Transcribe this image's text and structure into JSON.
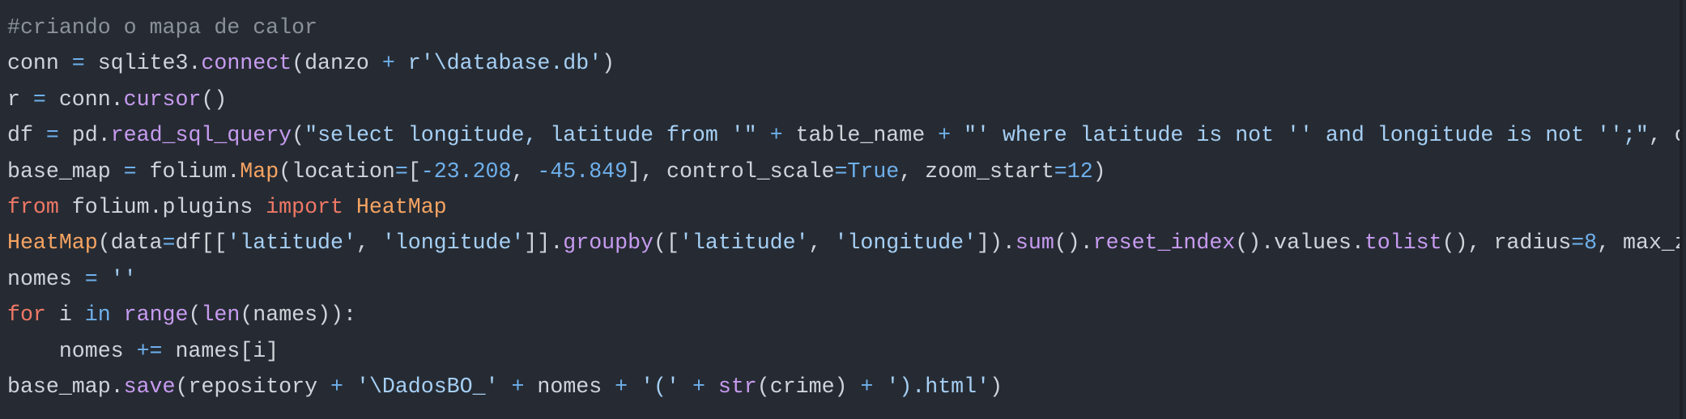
{
  "colors": {
    "background": "#262b33",
    "plain": "#d0d4da",
    "comment": "#8a919b",
    "operator": "#6fb0ec",
    "function": "#c79bf0",
    "string": "#a6cff4",
    "number": "#6fb0ec",
    "keyword": "#f07866",
    "class_name": "#f7a462"
  },
  "code": {
    "lines": [
      [
        [
          "comment",
          "#criando o mapa de calor"
        ]
      ],
      [
        [
          "plain",
          "conn "
        ],
        [
          "operator",
          "="
        ],
        [
          "plain",
          " sqlite3."
        ],
        [
          "function",
          "connect"
        ],
        [
          "plain",
          "(danzo "
        ],
        [
          "operator",
          "+"
        ],
        [
          "plain",
          " "
        ],
        [
          "string",
          "r'\\database.db'"
        ],
        [
          "plain",
          ")"
        ]
      ],
      [
        [
          "plain",
          "r "
        ],
        [
          "operator",
          "="
        ],
        [
          "plain",
          " conn."
        ],
        [
          "function",
          "cursor"
        ],
        [
          "plain",
          "()"
        ]
      ],
      [
        [
          "plain",
          "df "
        ],
        [
          "operator",
          "="
        ],
        [
          "plain",
          " pd."
        ],
        [
          "function",
          "read_sql_query"
        ],
        [
          "plain",
          "("
        ],
        [
          "string",
          "\"select longitude, latitude from '\""
        ],
        [
          "plain",
          " "
        ],
        [
          "operator",
          "+"
        ],
        [
          "plain",
          " table_name "
        ],
        [
          "operator",
          "+"
        ],
        [
          "plain",
          " "
        ],
        [
          "string",
          "\"' where latitude is not '' and longitude is not '';\""
        ],
        [
          "plain",
          ", c"
        ]
      ],
      [
        [
          "plain",
          "base_map "
        ],
        [
          "operator",
          "="
        ],
        [
          "plain",
          " folium."
        ],
        [
          "class_name",
          "Map"
        ],
        [
          "plain",
          "(location"
        ],
        [
          "operator",
          "="
        ],
        [
          "plain",
          "["
        ],
        [
          "number",
          "-23.208"
        ],
        [
          "plain",
          ", "
        ],
        [
          "number",
          "-45.849"
        ],
        [
          "plain",
          "], control_scale"
        ],
        [
          "operator",
          "="
        ],
        [
          "number",
          "True"
        ],
        [
          "plain",
          ", zoom_start"
        ],
        [
          "operator",
          "="
        ],
        [
          "number",
          "12"
        ],
        [
          "plain",
          ")"
        ]
      ],
      [
        [
          "keyword",
          "from"
        ],
        [
          "plain",
          " folium.plugins "
        ],
        [
          "keyword",
          "import"
        ],
        [
          "plain",
          " "
        ],
        [
          "class_name",
          "HeatMap"
        ]
      ],
      [
        [
          "class_name",
          "HeatMap"
        ],
        [
          "plain",
          "(data"
        ],
        [
          "operator",
          "="
        ],
        [
          "plain",
          "df[["
        ],
        [
          "string",
          "'latitude'"
        ],
        [
          "plain",
          ", "
        ],
        [
          "string",
          "'longitude'"
        ],
        [
          "plain",
          "]]."
        ],
        [
          "function",
          "groupby"
        ],
        [
          "plain",
          "(["
        ],
        [
          "string",
          "'latitude'"
        ],
        [
          "plain",
          ", "
        ],
        [
          "string",
          "'longitude'"
        ],
        [
          "plain",
          "])."
        ],
        [
          "function",
          "sum"
        ],
        [
          "plain",
          "()."
        ],
        [
          "function",
          "reset_index"
        ],
        [
          "plain",
          "().values."
        ],
        [
          "function",
          "tolist"
        ],
        [
          "plain",
          "(), radius"
        ],
        [
          "operator",
          "="
        ],
        [
          "number",
          "8"
        ],
        [
          "plain",
          ", max_z"
        ]
      ],
      [
        [
          "plain",
          "nomes "
        ],
        [
          "operator",
          "="
        ],
        [
          "plain",
          " "
        ],
        [
          "string",
          "''"
        ]
      ],
      [
        [
          "keyword",
          "for"
        ],
        [
          "plain",
          " i "
        ],
        [
          "operator",
          "in"
        ],
        [
          "plain",
          " "
        ],
        [
          "function",
          "range"
        ],
        [
          "plain",
          "("
        ],
        [
          "function",
          "len"
        ],
        [
          "plain",
          "(names)):"
        ]
      ],
      [
        [
          "plain",
          "    nomes "
        ],
        [
          "operator",
          "+="
        ],
        [
          "plain",
          " names[i]"
        ]
      ],
      [
        [
          "plain",
          "base_map."
        ],
        [
          "function",
          "save"
        ],
        [
          "plain",
          "(repository "
        ],
        [
          "operator",
          "+"
        ],
        [
          "plain",
          " "
        ],
        [
          "string",
          "'\\DadosBO_'"
        ],
        [
          "plain",
          " "
        ],
        [
          "operator",
          "+"
        ],
        [
          "plain",
          " nomes "
        ],
        [
          "operator",
          "+"
        ],
        [
          "plain",
          " "
        ],
        [
          "string",
          "'('"
        ],
        [
          "plain",
          " "
        ],
        [
          "operator",
          "+"
        ],
        [
          "plain",
          " "
        ],
        [
          "function",
          "str"
        ],
        [
          "plain",
          "(crime) "
        ],
        [
          "operator",
          "+"
        ],
        [
          "plain",
          " "
        ],
        [
          "string",
          "').html'"
        ],
        [
          "plain",
          ")"
        ]
      ]
    ]
  }
}
